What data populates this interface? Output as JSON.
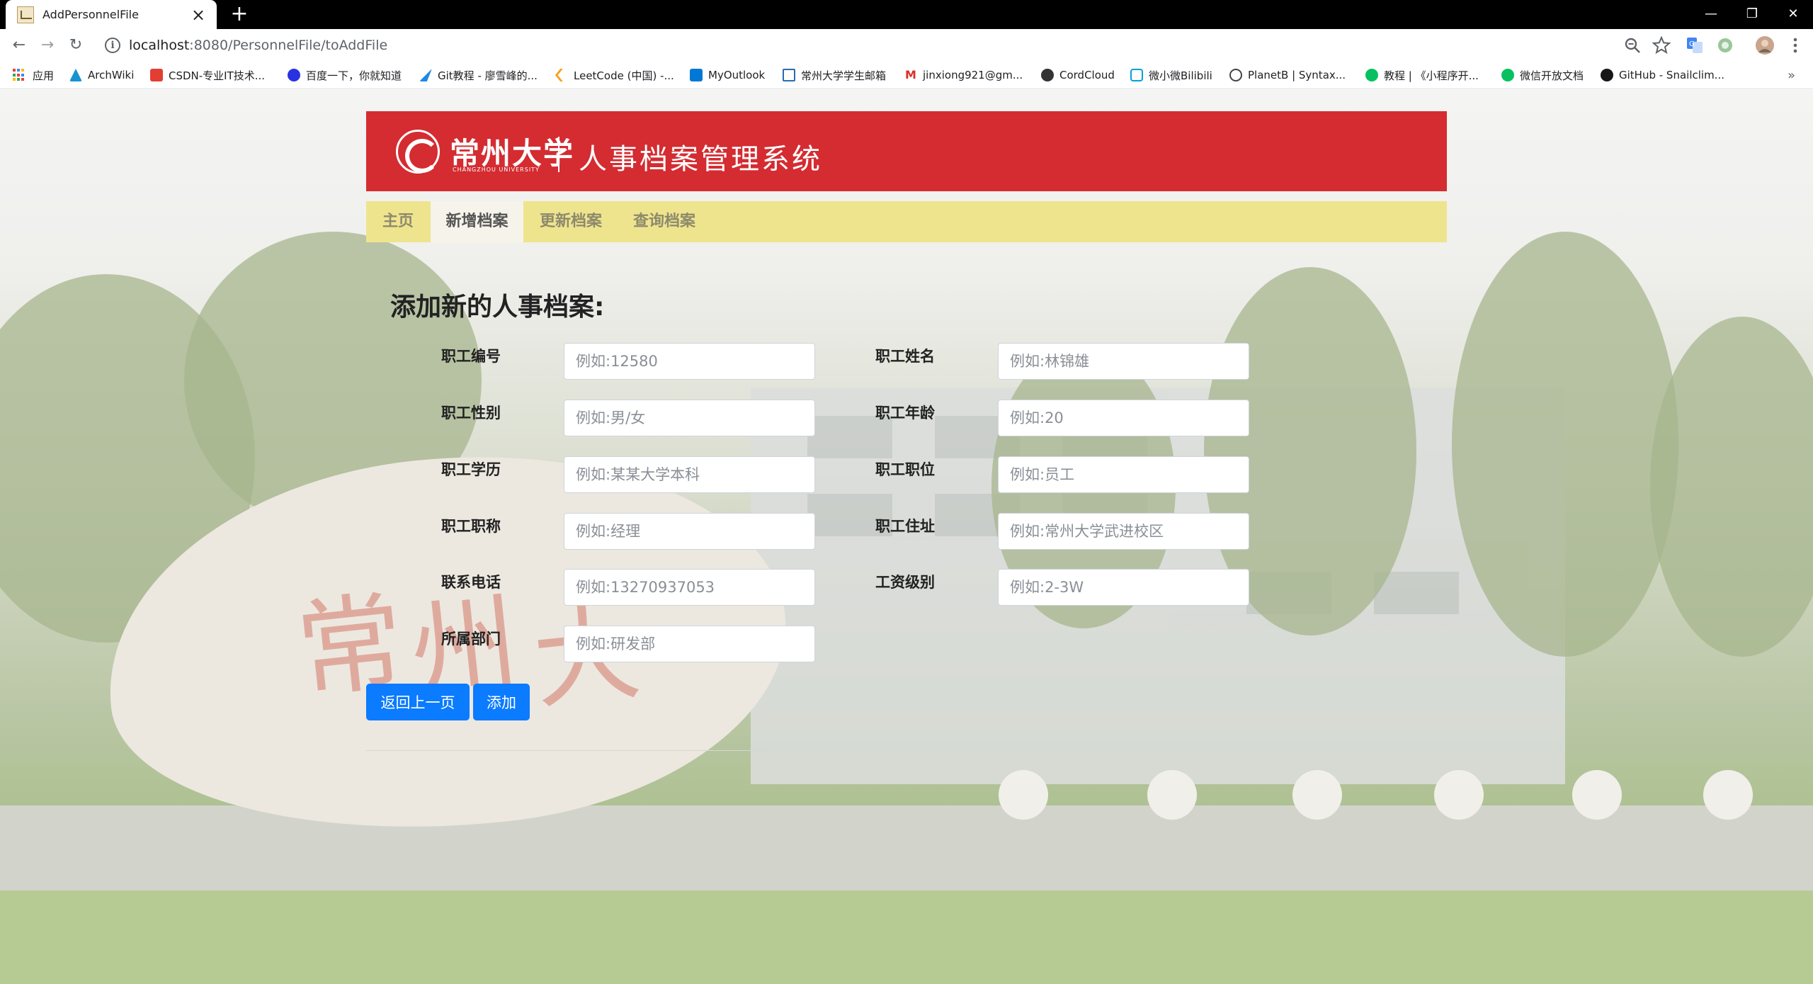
{
  "browser": {
    "tab_title": "AddPersonnelFile",
    "tab_close": "×",
    "new_tab": "+",
    "url_host": "localhost",
    "url_path": ":8080/PersonnelFile/toAddFile",
    "window_controls": {
      "minimize": "—",
      "restore": "❐",
      "close": "✕"
    },
    "nav": {
      "back": "←",
      "forward": "→",
      "reload": "↻"
    }
  },
  "bookmarks": [
    {
      "label": "应用",
      "icon": "apps-icon",
      "color": "#4285f4"
    },
    {
      "label": "ArchWiki",
      "icon": "archwiki-icon",
      "color": "#1793d1"
    },
    {
      "label": "CSDN-专业IT技术...",
      "icon": "csdn-icon",
      "color": "#e33e33"
    },
    {
      "label": "百度一下，你就知道",
      "icon": "baidu-icon",
      "color": "#2932e1"
    },
    {
      "label": "Git教程 - 廖雪峰的...",
      "icon": "liaoxuefeng-icon",
      "color": "#1e88e5"
    },
    {
      "label": "LeetCode (中国) -...",
      "icon": "leetcode-icon",
      "color": "#f89f1b"
    },
    {
      "label": "MyOutlook",
      "icon": "outlook-icon",
      "color": "#0078d4"
    },
    {
      "label": "常州大学学生邮箱",
      "icon": "mail-icon",
      "color": "#2b6cb0"
    },
    {
      "label": "jinxiong921@gm...",
      "icon": "gmail-icon",
      "color": "#d93025"
    },
    {
      "label": "CordCloud",
      "icon": "cordcloud-icon",
      "color": "#333333"
    },
    {
      "label": "微小微Bilibili",
      "icon": "bilibili-icon",
      "color": "#00a1d6"
    },
    {
      "label": "PlanetB | Syntax...",
      "icon": "planetb-icon",
      "color": "#444444"
    },
    {
      "label": "教程 | 《小程序开...",
      "icon": "wechat-icon",
      "color": "#07c160"
    },
    {
      "label": "微信开放文档",
      "icon": "wechat-icon",
      "color": "#07c160"
    },
    {
      "label": "GitHub - Snailclim...",
      "icon": "github-icon",
      "color": "#181717"
    }
  ],
  "bookmarks_overflow": "»",
  "header": {
    "logo_cn": "常州大学",
    "logo_en": "CHANGZHOU UNIVERSITY",
    "system_title": "人事档案管理系统"
  },
  "navbar": [
    {
      "label": "主页",
      "active": false
    },
    {
      "label": "新增档案",
      "active": true
    },
    {
      "label": "更新档案",
      "active": false
    },
    {
      "label": "查询档案",
      "active": false
    }
  ],
  "form": {
    "title": "添加新的人事档案:",
    "fields": {
      "employee_id": {
        "label": "职工编号",
        "placeholder": "例如:12580"
      },
      "employee_name": {
        "label": "职工姓名",
        "placeholder": "例如:林锦雄"
      },
      "gender": {
        "label": "职工性别",
        "placeholder": "例如:男/女"
      },
      "age": {
        "label": "职工年龄",
        "placeholder": "例如:20"
      },
      "education": {
        "label": "职工学历",
        "placeholder": "例如:某某大学本科"
      },
      "position": {
        "label": "职工职位",
        "placeholder": "例如:员工"
      },
      "job_title": {
        "label": "职工职称",
        "placeholder": "例如:经理"
      },
      "address": {
        "label": "职工住址",
        "placeholder": "例如:常州大学武进校区"
      },
      "phone": {
        "label": "联系电话",
        "placeholder": "例如:13270937053"
      },
      "salary_level": {
        "label": "工资级别",
        "placeholder": "例如:2-3W"
      },
      "department": {
        "label": "所属部门",
        "placeholder": "例如:研发部"
      }
    },
    "back_button": "返回上一页",
    "submit_button": "添加"
  },
  "colors": {
    "header_red": "#d42c31",
    "nav_yellow": "#efe48e",
    "primary_blue": "#0b7bff"
  }
}
